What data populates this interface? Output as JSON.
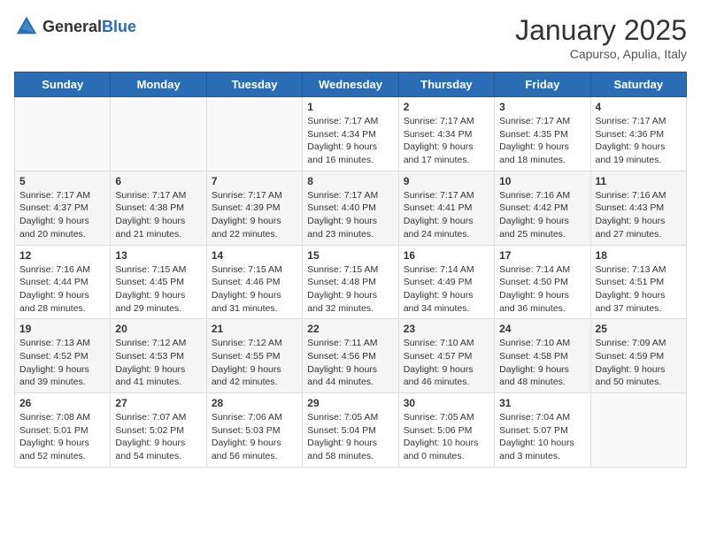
{
  "logo": {
    "text_general": "General",
    "text_blue": "Blue"
  },
  "title": "January 2025",
  "location": "Capurso, Apulia, Italy",
  "weekdays": [
    "Sunday",
    "Monday",
    "Tuesday",
    "Wednesday",
    "Thursday",
    "Friday",
    "Saturday"
  ],
  "weeks": [
    [
      {
        "day": "",
        "sunrise": "",
        "sunset": "",
        "daylight": ""
      },
      {
        "day": "",
        "sunrise": "",
        "sunset": "",
        "daylight": ""
      },
      {
        "day": "",
        "sunrise": "",
        "sunset": "",
        "daylight": ""
      },
      {
        "day": "1",
        "sunrise": "Sunrise: 7:17 AM",
        "sunset": "Sunset: 4:34 PM",
        "daylight": "Daylight: 9 hours and 16 minutes."
      },
      {
        "day": "2",
        "sunrise": "Sunrise: 7:17 AM",
        "sunset": "Sunset: 4:34 PM",
        "daylight": "Daylight: 9 hours and 17 minutes."
      },
      {
        "day": "3",
        "sunrise": "Sunrise: 7:17 AM",
        "sunset": "Sunset: 4:35 PM",
        "daylight": "Daylight: 9 hours and 18 minutes."
      },
      {
        "day": "4",
        "sunrise": "Sunrise: 7:17 AM",
        "sunset": "Sunset: 4:36 PM",
        "daylight": "Daylight: 9 hours and 19 minutes."
      }
    ],
    [
      {
        "day": "5",
        "sunrise": "Sunrise: 7:17 AM",
        "sunset": "Sunset: 4:37 PM",
        "daylight": "Daylight: 9 hours and 20 minutes."
      },
      {
        "day": "6",
        "sunrise": "Sunrise: 7:17 AM",
        "sunset": "Sunset: 4:38 PM",
        "daylight": "Daylight: 9 hours and 21 minutes."
      },
      {
        "day": "7",
        "sunrise": "Sunrise: 7:17 AM",
        "sunset": "Sunset: 4:39 PM",
        "daylight": "Daylight: 9 hours and 22 minutes."
      },
      {
        "day": "8",
        "sunrise": "Sunrise: 7:17 AM",
        "sunset": "Sunset: 4:40 PM",
        "daylight": "Daylight: 9 hours and 23 minutes."
      },
      {
        "day": "9",
        "sunrise": "Sunrise: 7:17 AM",
        "sunset": "Sunset: 4:41 PM",
        "daylight": "Daylight: 9 hours and 24 minutes."
      },
      {
        "day": "10",
        "sunrise": "Sunrise: 7:16 AM",
        "sunset": "Sunset: 4:42 PM",
        "daylight": "Daylight: 9 hours and 25 minutes."
      },
      {
        "day": "11",
        "sunrise": "Sunrise: 7:16 AM",
        "sunset": "Sunset: 4:43 PM",
        "daylight": "Daylight: 9 hours and 27 minutes."
      }
    ],
    [
      {
        "day": "12",
        "sunrise": "Sunrise: 7:16 AM",
        "sunset": "Sunset: 4:44 PM",
        "daylight": "Daylight: 9 hours and 28 minutes."
      },
      {
        "day": "13",
        "sunrise": "Sunrise: 7:15 AM",
        "sunset": "Sunset: 4:45 PM",
        "daylight": "Daylight: 9 hours and 29 minutes."
      },
      {
        "day": "14",
        "sunrise": "Sunrise: 7:15 AM",
        "sunset": "Sunset: 4:46 PM",
        "daylight": "Daylight: 9 hours and 31 minutes."
      },
      {
        "day": "15",
        "sunrise": "Sunrise: 7:15 AM",
        "sunset": "Sunset: 4:48 PM",
        "daylight": "Daylight: 9 hours and 32 minutes."
      },
      {
        "day": "16",
        "sunrise": "Sunrise: 7:14 AM",
        "sunset": "Sunset: 4:49 PM",
        "daylight": "Daylight: 9 hours and 34 minutes."
      },
      {
        "day": "17",
        "sunrise": "Sunrise: 7:14 AM",
        "sunset": "Sunset: 4:50 PM",
        "daylight": "Daylight: 9 hours and 36 minutes."
      },
      {
        "day": "18",
        "sunrise": "Sunrise: 7:13 AM",
        "sunset": "Sunset: 4:51 PM",
        "daylight": "Daylight: 9 hours and 37 minutes."
      }
    ],
    [
      {
        "day": "19",
        "sunrise": "Sunrise: 7:13 AM",
        "sunset": "Sunset: 4:52 PM",
        "daylight": "Daylight: 9 hours and 39 minutes."
      },
      {
        "day": "20",
        "sunrise": "Sunrise: 7:12 AM",
        "sunset": "Sunset: 4:53 PM",
        "daylight": "Daylight: 9 hours and 41 minutes."
      },
      {
        "day": "21",
        "sunrise": "Sunrise: 7:12 AM",
        "sunset": "Sunset: 4:55 PM",
        "daylight": "Daylight: 9 hours and 42 minutes."
      },
      {
        "day": "22",
        "sunrise": "Sunrise: 7:11 AM",
        "sunset": "Sunset: 4:56 PM",
        "daylight": "Daylight: 9 hours and 44 minutes."
      },
      {
        "day": "23",
        "sunrise": "Sunrise: 7:10 AM",
        "sunset": "Sunset: 4:57 PM",
        "daylight": "Daylight: 9 hours and 46 minutes."
      },
      {
        "day": "24",
        "sunrise": "Sunrise: 7:10 AM",
        "sunset": "Sunset: 4:58 PM",
        "daylight": "Daylight: 9 hours and 48 minutes."
      },
      {
        "day": "25",
        "sunrise": "Sunrise: 7:09 AM",
        "sunset": "Sunset: 4:59 PM",
        "daylight": "Daylight: 9 hours and 50 minutes."
      }
    ],
    [
      {
        "day": "26",
        "sunrise": "Sunrise: 7:08 AM",
        "sunset": "Sunset: 5:01 PM",
        "daylight": "Daylight: 9 hours and 52 minutes."
      },
      {
        "day": "27",
        "sunrise": "Sunrise: 7:07 AM",
        "sunset": "Sunset: 5:02 PM",
        "daylight": "Daylight: 9 hours and 54 minutes."
      },
      {
        "day": "28",
        "sunrise": "Sunrise: 7:06 AM",
        "sunset": "Sunset: 5:03 PM",
        "daylight": "Daylight: 9 hours and 56 minutes."
      },
      {
        "day": "29",
        "sunrise": "Sunrise: 7:05 AM",
        "sunset": "Sunset: 5:04 PM",
        "daylight": "Daylight: 9 hours and 58 minutes."
      },
      {
        "day": "30",
        "sunrise": "Sunrise: 7:05 AM",
        "sunset": "Sunset: 5:06 PM",
        "daylight": "Daylight: 10 hours and 0 minutes."
      },
      {
        "day": "31",
        "sunrise": "Sunrise: 7:04 AM",
        "sunset": "Sunset: 5:07 PM",
        "daylight": "Daylight: 10 hours and 3 minutes."
      },
      {
        "day": "",
        "sunrise": "",
        "sunset": "",
        "daylight": ""
      }
    ]
  ]
}
